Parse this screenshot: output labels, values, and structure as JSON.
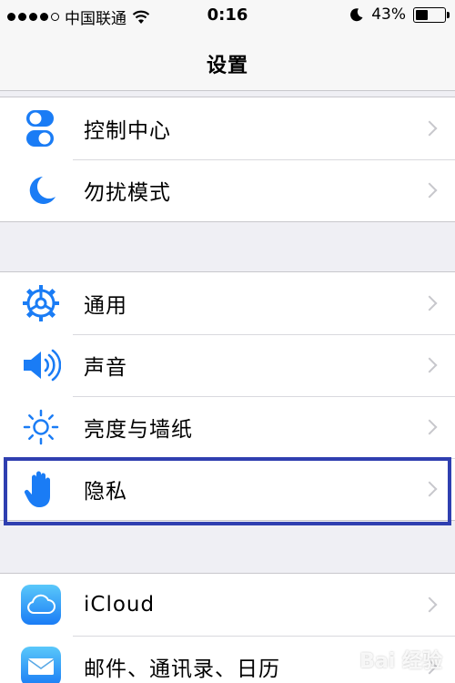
{
  "status_bar": {
    "carrier": "中国联通",
    "time": "0:16",
    "battery_text": "43%",
    "battery_level": 0.43,
    "signal_bars_filled": 4,
    "signal_bars_total": 5
  },
  "nav": {
    "title": "设置"
  },
  "groups": [
    {
      "items": [
        {
          "label": "控制中心",
          "icon": "toggle-switches-icon"
        },
        {
          "label": "勿扰模式",
          "icon": "moon-icon"
        }
      ]
    },
    {
      "items": [
        {
          "label": "通用",
          "icon": "gear-icon"
        },
        {
          "label": "声音",
          "icon": "speaker-icon"
        },
        {
          "label": "亮度与墙纸",
          "icon": "sun-icon"
        },
        {
          "label": "隐私",
          "icon": "hand-icon",
          "highlighted": true
        }
      ]
    },
    {
      "items": [
        {
          "label": "iCloud",
          "icon": "cloud-icon"
        },
        {
          "label": "邮件、通讯录、日历",
          "icon": "mail-icon"
        }
      ]
    }
  ],
  "colors": {
    "accent_blue": "#1a7cf5",
    "highlight_border": "#2f3fb0",
    "background": "#efeff4"
  },
  "watermark": "Bai 经验"
}
